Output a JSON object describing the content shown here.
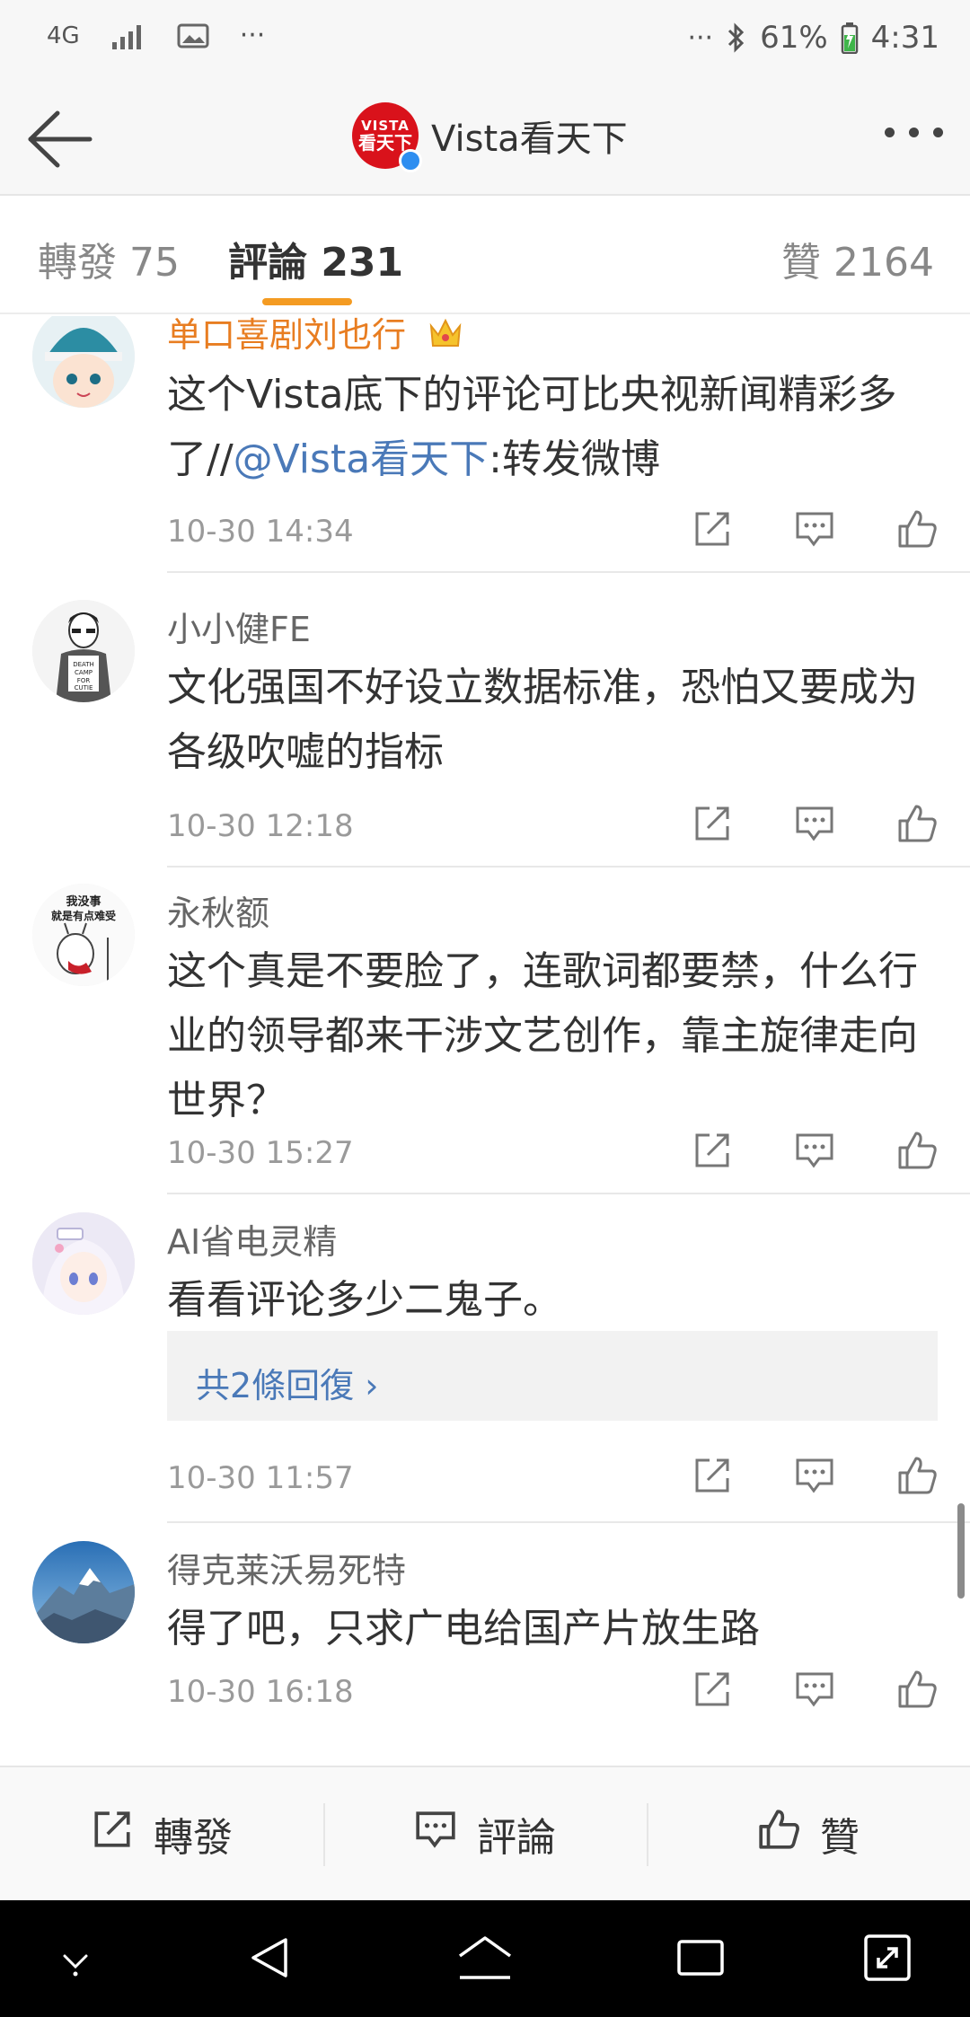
{
  "status_bar": {
    "network": "4G",
    "overflow_left": "···",
    "overflow_right": "···",
    "battery": "61%",
    "time": "4:31"
  },
  "header": {
    "title": "Vista看天下",
    "avatar_text_top": "VISTA",
    "avatar_text_main": "看天下",
    "back_icon": "back-arrow-icon",
    "more_icon": "more-dots-icon"
  },
  "tabs": [
    {
      "label": "轉發 75"
    },
    {
      "label": "評論 231"
    },
    {
      "label": "贊 2164"
    }
  ],
  "comments": [
    {
      "name": "单口喜剧刘也行",
      "text_before": "这个Vista底下的评论可比央视新闻精彩多了//",
      "mention": "@Vista看天下",
      "text_after": ":转发微博",
      "time": "10-30 14:34"
    },
    {
      "name": "小小健FE",
      "text": "文化强国不好设立数据标准，恐怕又要成为各级吹嘘的指标",
      "time": "10-30 12:18",
      "avatar_text": "DEATH CAMP FOR CUTIE"
    },
    {
      "name": "永秋额",
      "text": "这个真是不要脸了，连歌词都要禁，什么行业的领导都来干涉文艺创作，靠主旋律走向世界？",
      "time": "10-30 15:27",
      "avatar_text": "我没事就是有点难受"
    },
    {
      "name": "AI省电灵精",
      "text": "看看评论多少二鬼子。",
      "replies": "共2條回復 ›",
      "time": "10-30 11:57"
    },
    {
      "name": "得克莱沃易死特",
      "text": "得了吧，只求广电给国产片放生路",
      "time": "10-30 16:18"
    }
  ],
  "bottom_bar": {
    "repost": "轉發",
    "comment": "評論",
    "like": "贊"
  },
  "colors": {
    "accent": "#f49b22",
    "mention": "#4a79b8",
    "vip_name": "#e87d21",
    "brand_red": "#d9121b"
  }
}
